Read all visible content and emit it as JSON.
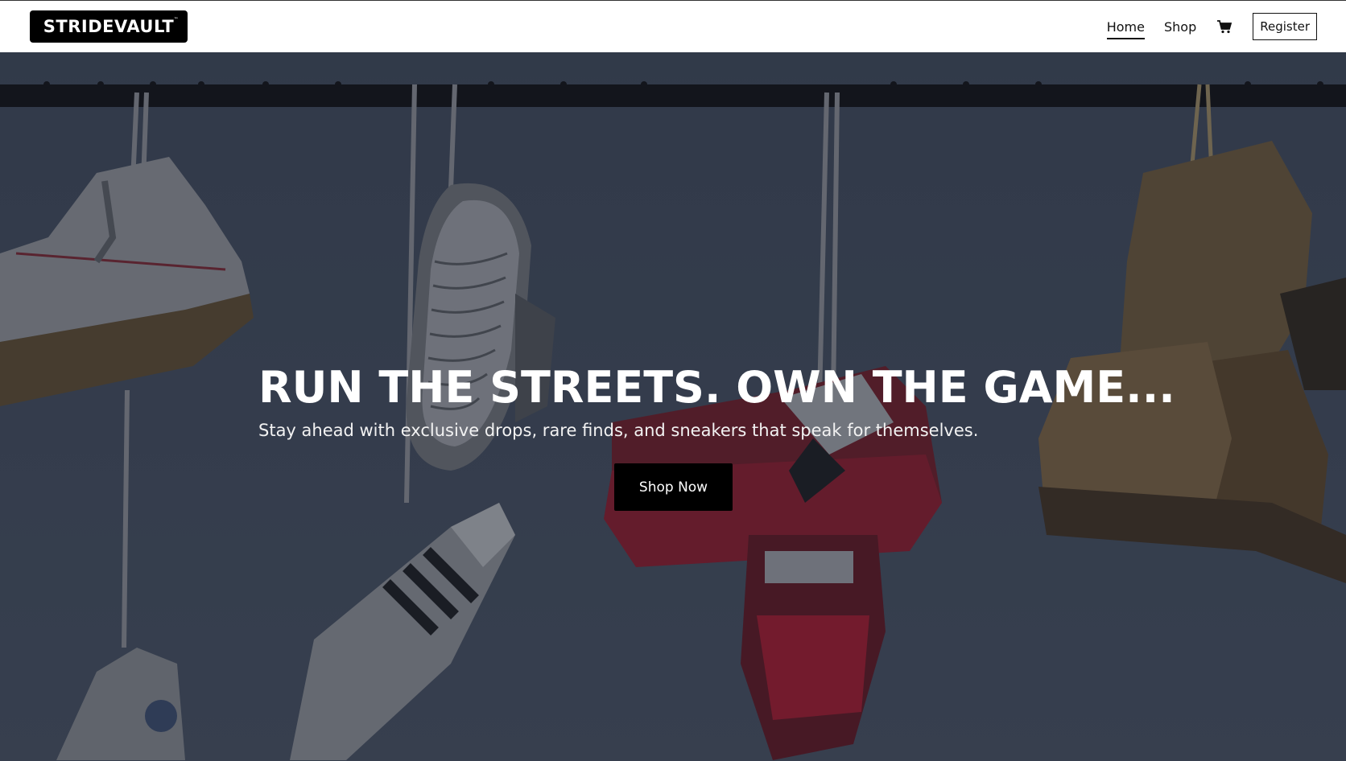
{
  "brand": {
    "name": "STRIDEVAULT",
    "trademark": "™"
  },
  "nav": {
    "home": "Home",
    "shop": "Shop",
    "cart_icon": "cart-icon",
    "register": "Register"
  },
  "hero": {
    "title": "RUN THE STREETS. OWN THE GAME...",
    "subtitle": "Stay ahead with exclusive drops, rare finds, and sneakers that speak for themselves.",
    "cta": "Shop Now"
  },
  "colors": {
    "navbar_bg": "#ffffff",
    "hero_overlay": "#3c4656",
    "button_bg": "#000000",
    "accent_red": "#a3152a"
  }
}
